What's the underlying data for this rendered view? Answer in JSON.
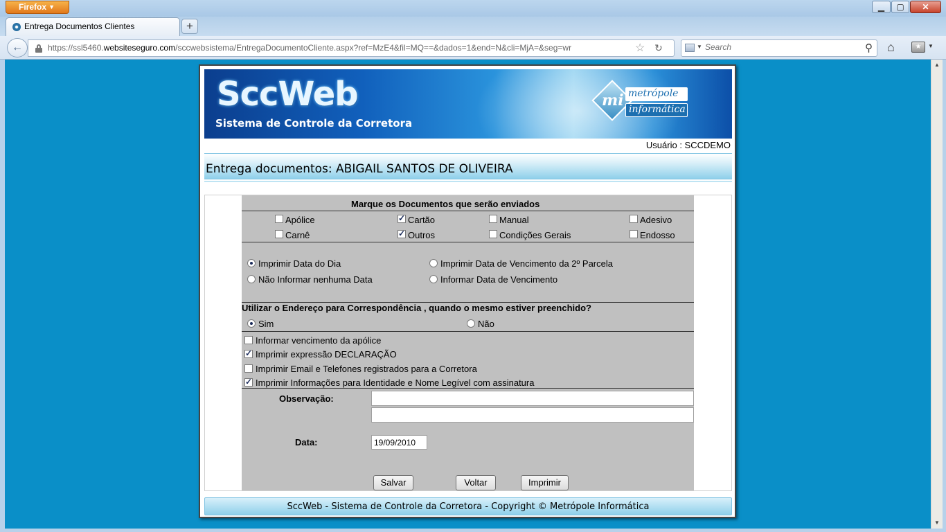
{
  "browser": {
    "app_button": "Firefox",
    "tab_title": "Entrega Documentos Clientes",
    "url_prefix": "https://ssl5460.",
    "url_domain": "websiteseguro.com",
    "url_path": "/sccwebsistema/EntregaDocumentoCliente.aspx?ref=MzE4&fil=MQ==&dados=1&end=N&cli=MjA=&seg=wr",
    "search_placeholder": "Search"
  },
  "banner": {
    "logo": "SccWeb",
    "subtitle": "Sistema de Controle da Corretora",
    "company_line1": "metrópole",
    "company_line2": "informática",
    "company_mark": "mi"
  },
  "user": {
    "label": "Usuário : SCCDEMO"
  },
  "page_title": "Entrega documentos: ABIGAIL SANTOS DE OLIVEIRA",
  "documents": {
    "heading": "Marque os Documentos que serão enviados",
    "items": [
      {
        "label": "Apólice",
        "checked": false
      },
      {
        "label": "Cartão",
        "checked": true
      },
      {
        "label": "Manual",
        "checked": false
      },
      {
        "label": "Adesivo",
        "checked": false
      },
      {
        "label": "Carnê",
        "checked": false
      },
      {
        "label": "Outros",
        "checked": true
      },
      {
        "label": "Condições Gerais",
        "checked": false
      },
      {
        "label": "Endosso",
        "checked": false
      }
    ]
  },
  "date_options": [
    {
      "label": "Imprimir Data do Dia",
      "selected": true
    },
    {
      "label": "Imprimir Data de Vencimento da 2º Parcela",
      "selected": false
    },
    {
      "label": "Não Informar nenhuma Data",
      "selected": false
    },
    {
      "label": "Informar Data de Vencimento",
      "selected": false
    }
  ],
  "address": {
    "question": "Utilizar o Endereço para Correspondência , quando o mesmo estiver preenchido?",
    "options": [
      {
        "label": "Sim",
        "selected": true
      },
      {
        "label": "Não",
        "selected": false
      }
    ]
  },
  "print_options": [
    {
      "label": "Informar vencimento da apólice",
      "checked": false
    },
    {
      "label": "Imprimir expressão DECLARAÇÃO",
      "checked": true
    },
    {
      "label": "Imprimir Email e Telefones registrados para a Corretora",
      "checked": false
    },
    {
      "label": "Imprimir Informações para Identidade e Nome Legível com assinatura",
      "checked": true
    }
  ],
  "fields": {
    "observacao_label": "Observação:",
    "observacao_line1": "",
    "observacao_line2": "",
    "data_label": "Data:",
    "data_value": "19/09/2010"
  },
  "buttons": {
    "save": "Salvar",
    "back": "Voltar",
    "print": "Imprimir"
  },
  "footer": "SccWeb - Sistema de Controle da Corretora - Copyright © Metrópole Informática",
  "colors": {
    "page_bg": "#0a8fc8",
    "form_bg": "#c0c0c0",
    "banner_dark": "#0b3e8e",
    "header_light": "#8fd0ea"
  }
}
